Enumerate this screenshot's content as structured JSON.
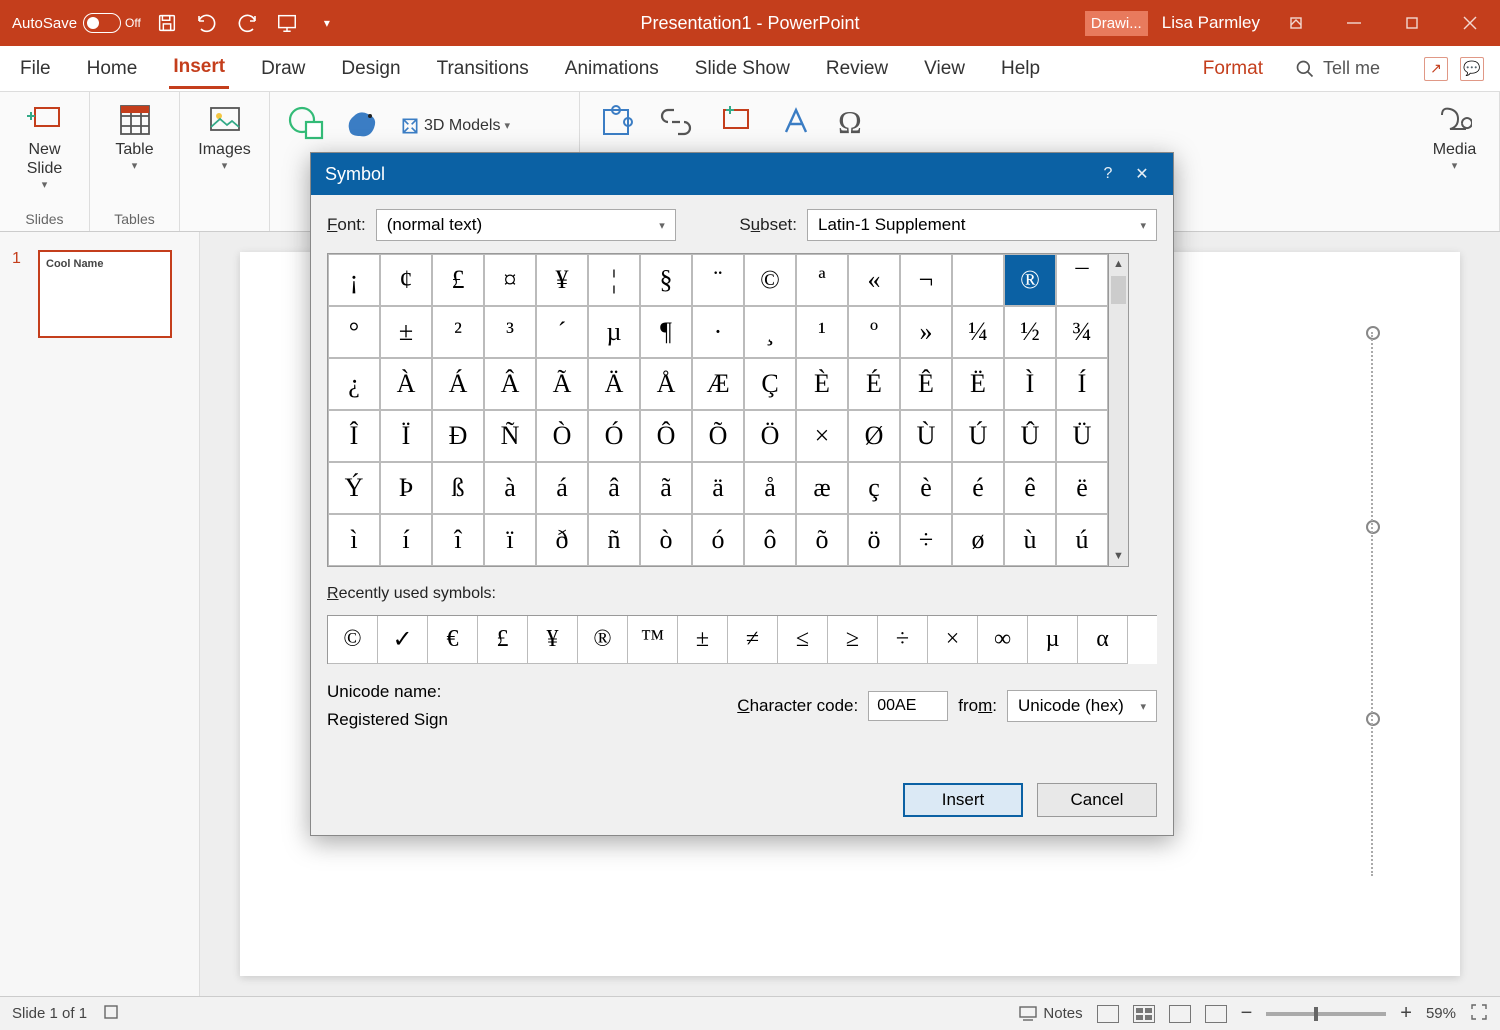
{
  "titlebar": {
    "autosave": "AutoSave",
    "toggle_state": "Off",
    "document": "Presentation1  -  PowerPoint",
    "drawi": "Drawi...",
    "user": "Lisa Parmley"
  },
  "tabs": {
    "file": "File",
    "home": "Home",
    "insert": "Insert",
    "draw": "Draw",
    "design": "Design",
    "transitions": "Transitions",
    "animations": "Animations",
    "slideshow": "Slide Show",
    "review": "Review",
    "view": "View",
    "help": "Help",
    "format": "Format",
    "tellme": "Tell me"
  },
  "ribbon": {
    "newslide": "New\nSlide",
    "slides": "Slides",
    "table": "Table",
    "tables": "Tables",
    "images": "Images",
    "models3d": "3D Models",
    "media": "Media"
  },
  "slides": {
    "thumb_text": "Cool Name"
  },
  "dialog": {
    "title": "Symbol",
    "font_label": "Font:",
    "font_value": "(normal text)",
    "subset_label": "Subset:",
    "subset_value": "Latin-1 Supplement",
    "grid": [
      [
        "¡",
        "¢",
        "£",
        "¤",
        "¥",
        "¦",
        "§",
        "¨",
        "©",
        "ª",
        "«",
        "¬",
        "­",
        "®",
        "¯"
      ],
      [
        "°",
        "±",
        "²",
        "³",
        "´",
        "µ",
        "¶",
        "·",
        "¸",
        "¹",
        "º",
        "»",
        "¼",
        "½",
        "¾"
      ],
      [
        "¿",
        "À",
        "Á",
        "Â",
        "Ã",
        "Ä",
        "Å",
        "Æ",
        "Ç",
        "È",
        "É",
        "Ê",
        "Ë",
        "Ì",
        "Í"
      ],
      [
        "Î",
        "Ï",
        "Ð",
        "Ñ",
        "Ò",
        "Ó",
        "Ô",
        "Õ",
        "Ö",
        "×",
        "Ø",
        "Ù",
        "Ú",
        "Û",
        "Ü"
      ],
      [
        "Ý",
        "Þ",
        "ß",
        "à",
        "á",
        "â",
        "ã",
        "ä",
        "å",
        "æ",
        "ç",
        "è",
        "é",
        "ê",
        "ë"
      ],
      [
        "ì",
        "í",
        "î",
        "ï",
        "ð",
        "ñ",
        "ò",
        "ó",
        "ô",
        "õ",
        "ö",
        "÷",
        "ø",
        "ù",
        "ú"
      ]
    ],
    "selected_row": 0,
    "selected_col": 13,
    "recent_label": "Recently used symbols:",
    "recent": [
      "©",
      "✓",
      "€",
      "£",
      "¥",
      "®",
      "™",
      "±",
      "≠",
      "≤",
      "≥",
      "÷",
      "×",
      "∞",
      "µ",
      "α"
    ],
    "unicode_name_label": "Unicode name:",
    "unicode_name": "Registered Sign",
    "cc_label": "Character code:",
    "cc_value": "00AE",
    "from_label": "from:",
    "from_value": "Unicode (hex)",
    "insert": "Insert",
    "cancel": "Cancel"
  },
  "status": {
    "slide": "Slide 1 of 1",
    "notes": "Notes",
    "zoom": "59%"
  }
}
